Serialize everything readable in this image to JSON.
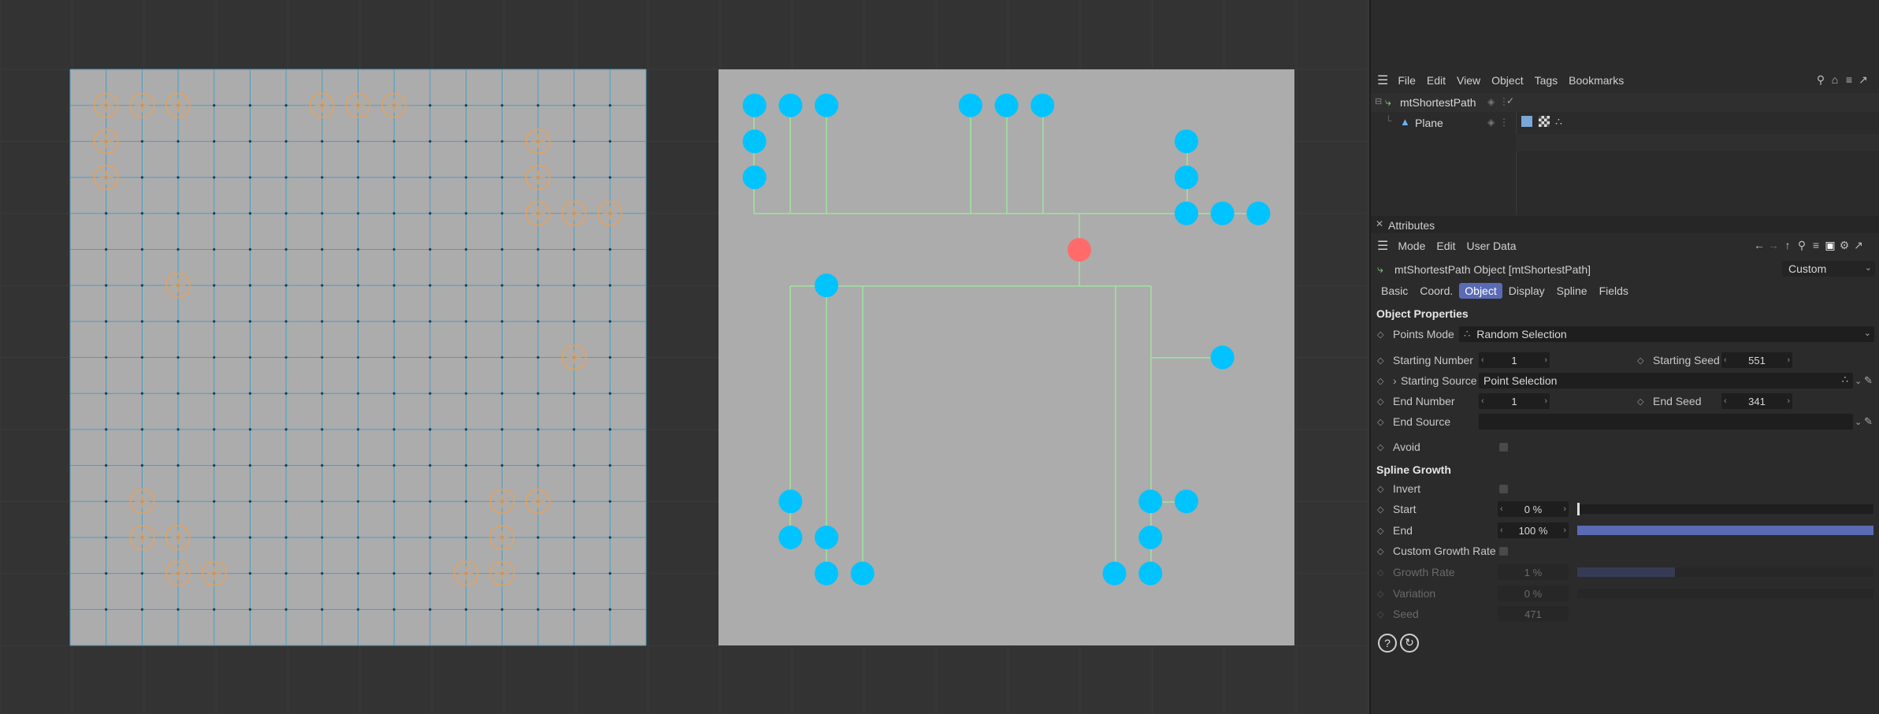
{
  "colors": {
    "viewport_bg": "#333333",
    "plane_fill": "#acacac",
    "grid_line": "#4a9ec4",
    "orange_marker": "#e8a15a",
    "cyan_point": "#00c3ff",
    "red_point": "#ff6b6b",
    "path_line": "#9fe39f",
    "accent": "#5a6bb5"
  },
  "menubar": {
    "items": [
      "File",
      "Edit",
      "View",
      "Object",
      "Tags",
      "Bookmarks"
    ]
  },
  "object_manager": {
    "objects": [
      {
        "name": "mtShortestPath",
        "icon": "spline-object-icon"
      },
      {
        "name": "Plane",
        "icon": "plane-object-icon"
      }
    ]
  },
  "attributes": {
    "panel_title": "Attributes",
    "menu": [
      "Mode",
      "Edit",
      "User Data"
    ],
    "object_title": "mtShortestPath Object [mtShortestPath]",
    "layout_dropdown": "Custom",
    "tabs": [
      "Basic",
      "Coord.",
      "Object",
      "Display",
      "Spline",
      "Fields"
    ],
    "active_tab": "Object",
    "object_properties": {
      "heading": "Object Properties",
      "points_mode_label": "Points Mode",
      "points_mode_value": "Random Selection",
      "starting_number_label": "Starting Number",
      "starting_number_value": "1",
      "starting_seed_label": "Starting Seed",
      "starting_seed_value": "551",
      "starting_source_label": "Starting Source",
      "starting_source_value": "Point Selection",
      "end_number_label": "End Number",
      "end_number_value": "1",
      "end_seed_label": "End Seed",
      "end_seed_value": "341",
      "end_source_label": "End Source",
      "end_source_value": "",
      "avoid_label": "Avoid"
    },
    "spline_growth": {
      "heading": "Spline Growth",
      "invert_label": "Invert",
      "start_label": "Start",
      "start_value": "0 %",
      "start_fraction": 0,
      "end_label": "End",
      "end_value": "100 %",
      "end_fraction": 1,
      "custom_growth_label": "Custom Growth Rate",
      "growth_rate_label": "Growth Rate",
      "growth_rate_value": "1 %",
      "growth_rate_fraction": 0.33,
      "variation_label": "Variation",
      "variation_value": "0 %",
      "seed_label": "Seed",
      "seed_value": "471"
    }
  }
}
